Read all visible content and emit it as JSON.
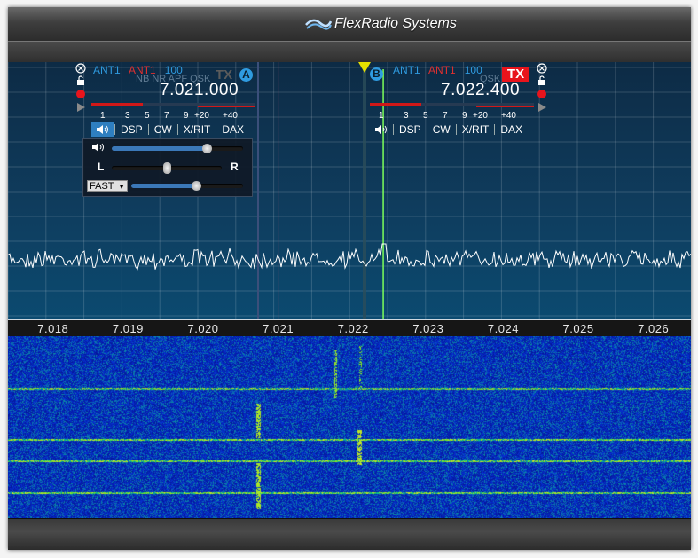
{
  "window": {
    "brand_name": "FlexRadio Systems"
  },
  "panadapter": {
    "freq_labels": [
      "7.018",
      "7.019",
      "7.020",
      "7.021",
      "7.022",
      "7.023",
      "7.024",
      "7.025",
      "7.026"
    ],
    "freq_min": 7.0174,
    "freq_max": 7.0265
  },
  "slice_a": {
    "letter": "A",
    "rx_ant": "ANT1",
    "tx_ant": "ANT1",
    "power": "100",
    "tx": "TX",
    "dsp_flags": "NB NR APF QSK",
    "frequency": "7.021.000",
    "tuned_mhz": 7.021,
    "meter_scale": [
      "1",
      "3",
      "5",
      "7",
      "9",
      "+20",
      "+40"
    ],
    "tabs": [
      "DSP",
      "CW",
      "X/RIT",
      "DAX"
    ],
    "audio": {
      "agc_mode": "FAST",
      "left_label": "L",
      "right_label": "R",
      "volume": 0.72,
      "pan": 0.5,
      "agc_threshold": 0.58
    }
  },
  "slice_b": {
    "letter": "B",
    "rx_ant": "ANT1",
    "tx_ant": "ANT1",
    "power": "100",
    "tx": "TX",
    "dsp_flags": "QSK",
    "frequency": "7.022.400",
    "tuned_mhz": 7.0224,
    "meter_scale": [
      "1",
      "3",
      "5",
      "7",
      "9",
      "+20",
      "+40"
    ],
    "tabs": [
      "DSP",
      "CW",
      "X/RIT",
      "DAX"
    ]
  },
  "icons": {
    "close": "close-icon",
    "lock": "lock-icon",
    "record": "record-icon",
    "play": "play-icon",
    "speaker": "speaker-icon"
  },
  "colors": {
    "accent": "#2f9be0",
    "tx_active": "#e8141c",
    "trace": "#ffffff",
    "slice_marker": "#e6e000",
    "waterfall_bg": "#0a1fb0",
    "waterfall_signal": "#6cff3a"
  }
}
